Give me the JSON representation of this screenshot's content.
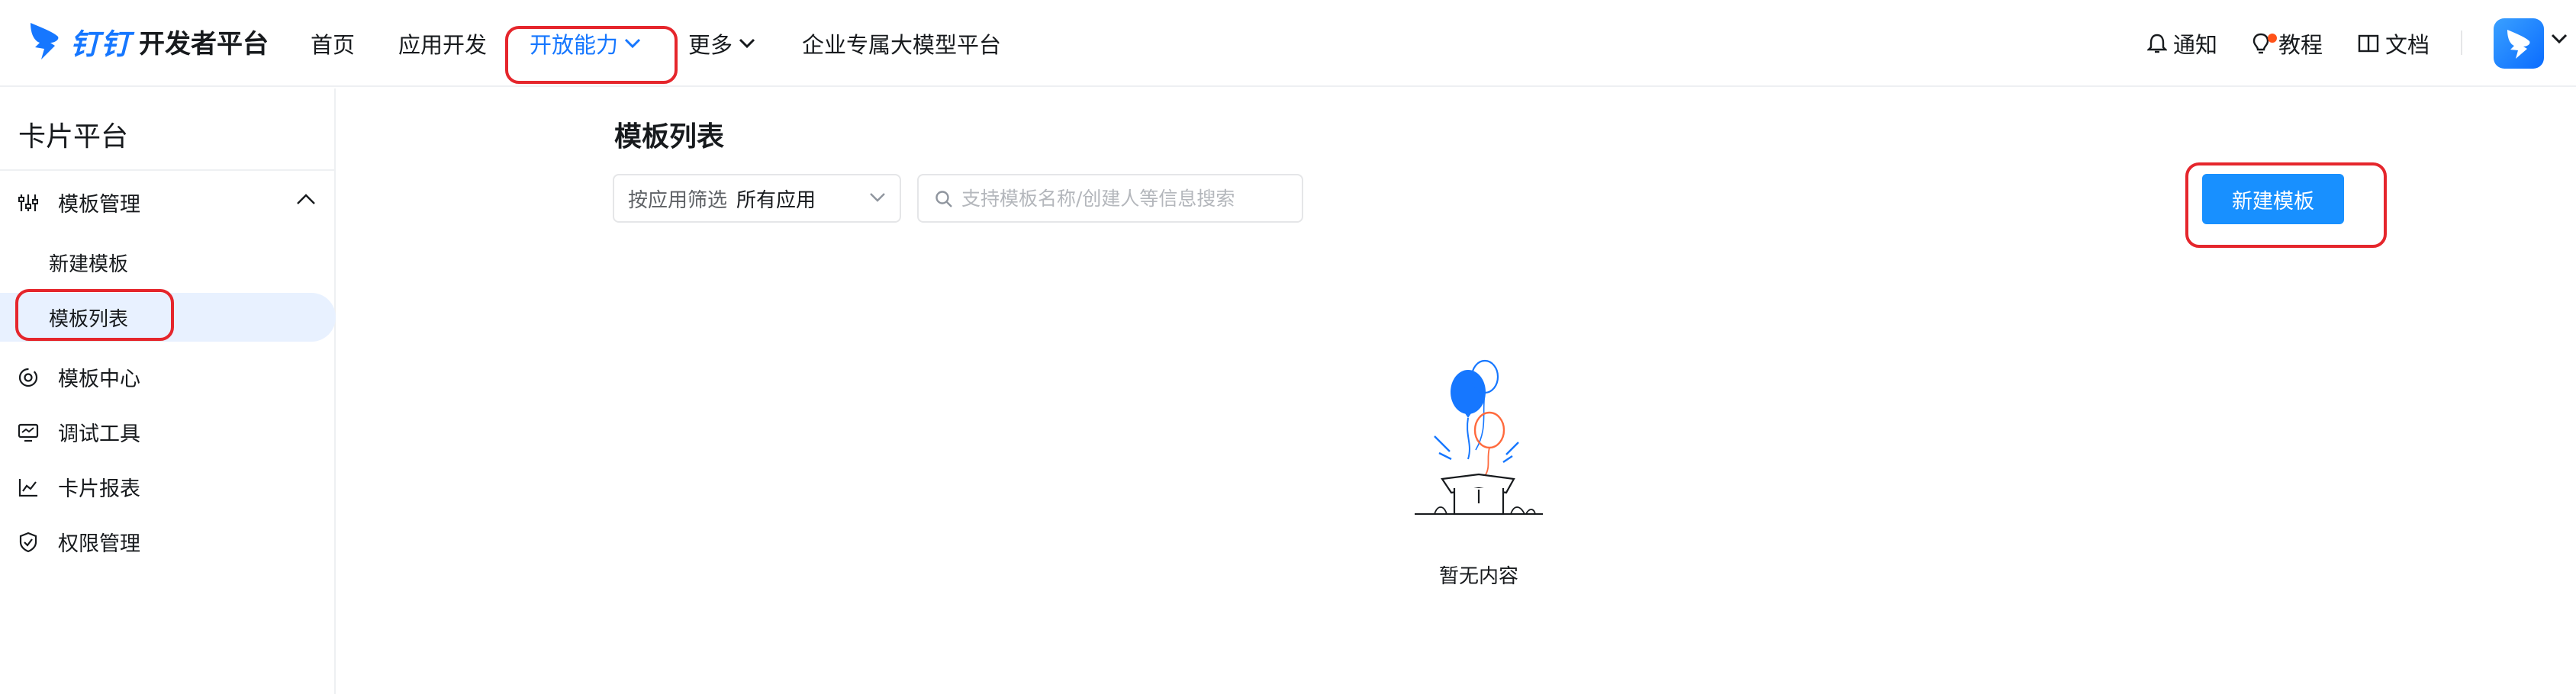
{
  "header": {
    "brand": "钉钉",
    "brand_suffix": "开发者平台",
    "nav": [
      {
        "label": "首页"
      },
      {
        "label": "应用开发"
      },
      {
        "label": "开放能力"
      },
      {
        "label": "更多"
      },
      {
        "label": "企业专属大模型平台"
      }
    ],
    "utilities": {
      "notify": "通知",
      "tutorial": "教程",
      "docs": "文档"
    },
    "accent_color": "#1677ff"
  },
  "sidebar": {
    "title": "卡片平台",
    "groups": [
      {
        "label": "模板管理",
        "icon": "sliders-icon",
        "expanded": true,
        "children": [
          {
            "label": "新建模板"
          },
          {
            "label": "模板列表",
            "selected": true
          }
        ]
      },
      {
        "label": "模板中心",
        "icon": "template-center-icon"
      },
      {
        "label": "调试工具",
        "icon": "monitor-icon"
      },
      {
        "label": "卡片报表",
        "icon": "line-chart-icon"
      },
      {
        "label": "权限管理",
        "icon": "shield-icon"
      }
    ]
  },
  "main": {
    "title": "模板列表",
    "filter": {
      "label": "按应用筛选",
      "value": "所有应用"
    },
    "search": {
      "placeholder": "支持模板名称/创建人等信息搜索",
      "value": ""
    },
    "create_button": "新建模板",
    "empty_text": "暂无内容",
    "primary_color": "#1890ff",
    "annotation_color": "#e5262c"
  }
}
